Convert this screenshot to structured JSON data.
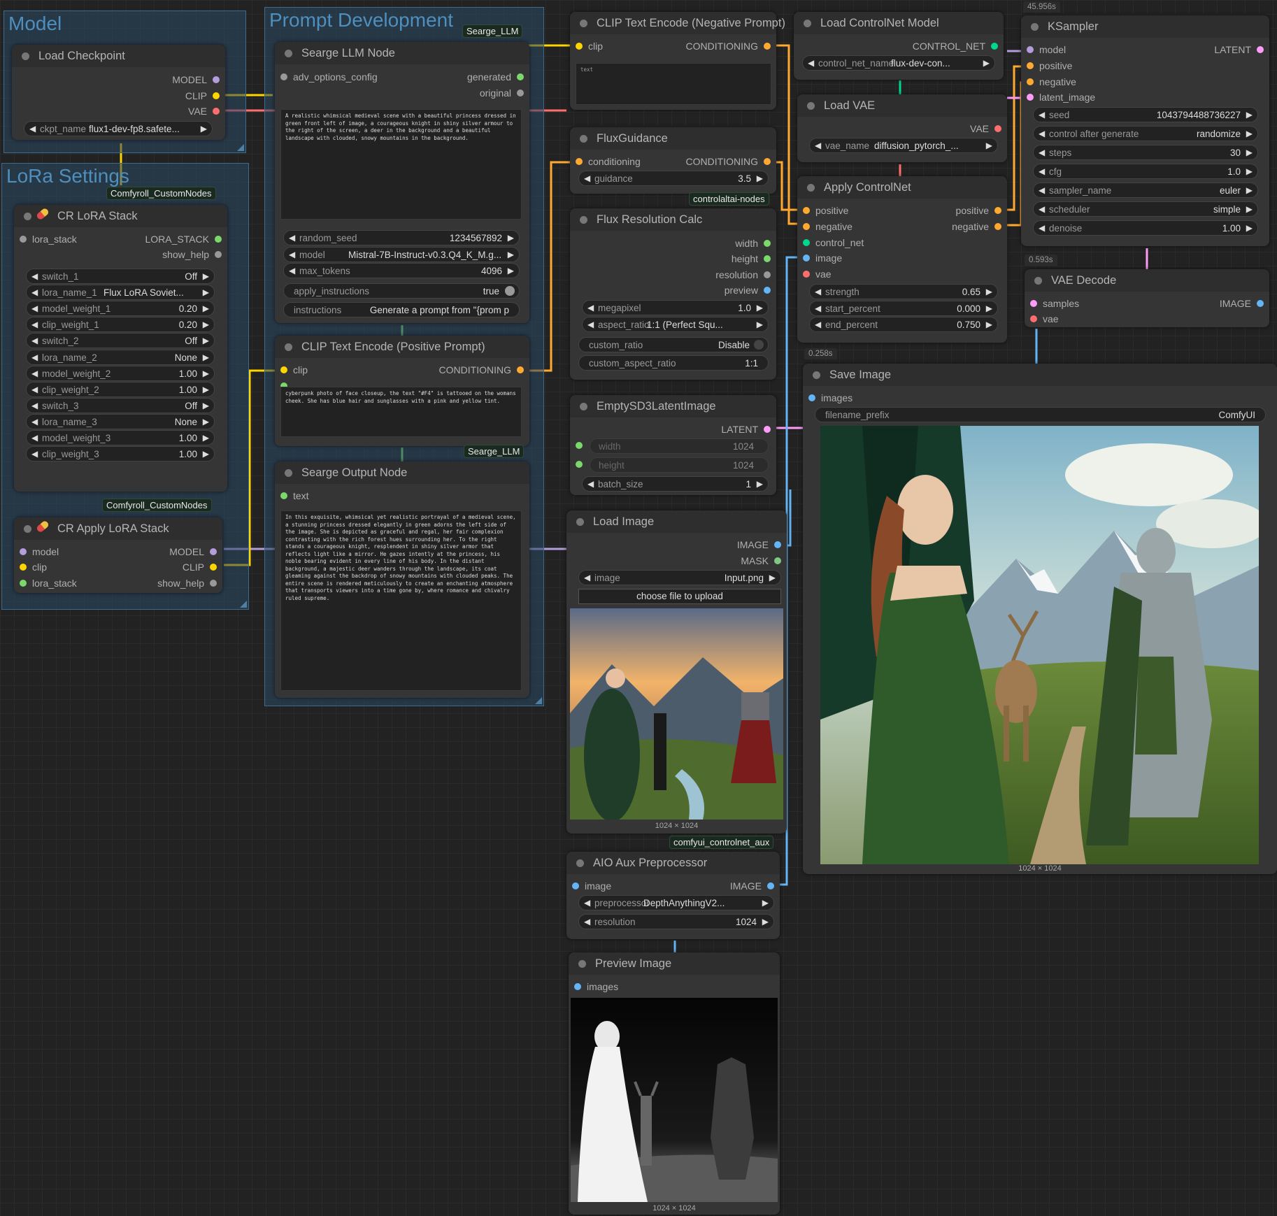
{
  "groups": {
    "model": "Model",
    "lora": "LoRa Settings",
    "prompt": "Prompt Development"
  },
  "badges": {
    "searge1": "Searge_LLM",
    "searge2": "Searge_LLM",
    "comfyroll1": "Comfyroll_CustomNodes",
    "comfyroll2": "Comfyroll_CustomNodes",
    "controlaltai": "controlaltai-nodes",
    "controlnet_aux": "comfyui_controlnet_aux"
  },
  "timings": {
    "ksampler": "45.956s",
    "vae_decode": "0.593s",
    "save_image": "0.258s"
  },
  "colors": {
    "model": "#b39ddb",
    "clip": "#ffd500",
    "vae": "#ff6e6e",
    "conditioning": "#ffa931",
    "latent": "#ff9cf9",
    "image": "#64b5f6",
    "mask": "#81c784",
    "control_net": "#00d78d",
    "generic": "#7bd96b"
  },
  "load_checkpoint": {
    "title": "Load Checkpoint",
    "out_model": "MODEL",
    "out_clip": "CLIP",
    "out_vae": "VAE",
    "w_ckpt_label": "ckpt_name",
    "w_ckpt_value": "flux1-dev-fp8.safete..."
  },
  "lora_stack": {
    "title": "CR LoRA Stack",
    "in_lora_stack": "lora_stack",
    "out_lora_stack": "LORA_STACK",
    "out_show_help": "show_help",
    "widgets": [
      {
        "label": "switch_1",
        "value": "Off"
      },
      {
        "label": "lora_name_1",
        "value": "Flux LoRA Soviet..."
      },
      {
        "label": "model_weight_1",
        "value": "0.20"
      },
      {
        "label": "clip_weight_1",
        "value": "0.20"
      },
      {
        "label": "switch_2",
        "value": "Off"
      },
      {
        "label": "lora_name_2",
        "value": "None"
      },
      {
        "label": "model_weight_2",
        "value": "1.00"
      },
      {
        "label": "clip_weight_2",
        "value": "1.00"
      },
      {
        "label": "switch_3",
        "value": "Off"
      },
      {
        "label": "lora_name_3",
        "value": "None"
      },
      {
        "label": "model_weight_3",
        "value": "1.00"
      },
      {
        "label": "clip_weight_3",
        "value": "1.00"
      }
    ]
  },
  "apply_lora": {
    "title": "CR Apply LoRA Stack",
    "in_model": "model",
    "in_clip": "clip",
    "in_lora_stack": "lora_stack",
    "out_model": "MODEL",
    "out_clip": "CLIP",
    "out_show_help": "show_help"
  },
  "searge_llm": {
    "title": "Searge LLM Node",
    "in_adv": "adv_options_config",
    "out_generated": "generated",
    "out_original": "original",
    "text": "A realistic whimsical medieval scene with a beautiful princess dressed in green front left of image, a courageous knight in shiny silver armour to the right of the screen, a deer in the background and a beautiful landscape with clouded, snowy mountains in the background.",
    "widgets": [
      {
        "label": "random_seed",
        "value": "1234567892"
      },
      {
        "label": "model",
        "value": "Mistral-7B-Instruct-v0.3.Q4_K_M.g..."
      },
      {
        "label": "max_tokens",
        "value": "4096"
      }
    ],
    "apply_label": "apply_instructions",
    "apply_value": "true",
    "instr_label": "instructions",
    "instr_value": "Generate a prompt from \"{prom p"
  },
  "clip_pos": {
    "title": "CLIP Text Encode (Positive Prompt)",
    "in_clip": "clip",
    "out_cond": "CONDITIONING",
    "text": "cyberpunk photo of face closeup, the text \"#F4\" is tattooed on the womans cheek. She has blue hair and sunglasses with a pink and yellow tint."
  },
  "searge_output": {
    "title": "Searge Output Node",
    "in_text": "text",
    "text": "In this exquisite, whimsical yet realistic portrayal of a medieval scene, a stunning princess dressed elegantly in green adorns the left side of the image. She is depicted as graceful and regal, her fair complexion contrasting with the rich forest hues surrounding her. To the right stands a courageous knight, resplendent in shiny silver armor that reflects light like a mirror. He gazes intently at the princess, his noble bearing evident in every line of his body. In the distant background, a majestic deer wanders through the landscape, its coat gleaming against the backdrop of snowy mountains with clouded peaks. The entire scene is rendered meticulously to create an enchanting atmosphere that transports viewers into a time gone by, where romance and chivalry ruled supreme."
  },
  "clip_neg": {
    "title": "CLIP Text Encode (Negative Prompt)",
    "in_clip": "clip",
    "out_cond": "CONDITIONING",
    "text": "text"
  },
  "flux_guidance": {
    "title": "FluxGuidance",
    "in_cond": "conditioning",
    "out_cond": "CONDITIONING",
    "w_label": "guidance",
    "w_value": "3.5"
  },
  "flux_res": {
    "title": "Flux Resolution Calc",
    "out_width": "width",
    "out_height": "height",
    "out_resolution": "resolution",
    "out_preview": "preview",
    "widgets": [
      {
        "label": "megapixel",
        "value": "1.0"
      },
      {
        "label": "aspect_ratio",
        "value": "1:1 (Perfect Squ..."
      }
    ],
    "custom_ratio_label": "custom_ratio",
    "custom_ratio_value": "Disable",
    "custom_aspect_label": "custom_aspect_ratio",
    "custom_aspect_value": "1:1"
  },
  "empty_latent": {
    "title": "EmptySD3LatentImage",
    "out_latent": "LATENT",
    "w_width_label": "width",
    "w_width_value": "1024",
    "w_height_label": "height",
    "w_height_value": "1024",
    "w_batch_label": "batch_size",
    "w_batch_value": "1"
  },
  "load_image": {
    "title": "Load Image",
    "out_image": "IMAGE",
    "out_mask": "MASK",
    "w_label": "image",
    "w_value": "Input.png",
    "upload": "choose file to upload",
    "caption": "1024 × 1024"
  },
  "aio": {
    "title": "AIO Aux Preprocessor",
    "in_image": "image",
    "out_image": "IMAGE",
    "w1_label": "preprocessor",
    "w1_value": "DepthAnythingV2...",
    "w2_label": "resolution",
    "w2_value": "1024"
  },
  "preview": {
    "title": "Preview Image",
    "in_images": "images",
    "caption": "1024 × 1024"
  },
  "load_controlnet": {
    "title": "Load ControlNet Model",
    "out_cn": "CONTROL_NET",
    "w_label": "control_net_name",
    "w_value": "flux-dev-con..."
  },
  "load_vae": {
    "title": "Load VAE",
    "out_vae": "VAE",
    "w_label": "vae_name",
    "w_value": "diffusion_pytorch_..."
  },
  "apply_cn": {
    "title": "Apply ControlNet",
    "in_pos": "positive",
    "in_neg": "negative",
    "in_cn": "control_net",
    "in_image": "image",
    "in_vae": "vae",
    "out_pos": "positive",
    "out_neg": "negative",
    "widgets": [
      {
        "label": "strength",
        "value": "0.65"
      },
      {
        "label": "start_percent",
        "value": "0.000"
      },
      {
        "label": "end_percent",
        "value": "0.750"
      }
    ]
  },
  "ksampler": {
    "title": "KSampler",
    "in_model": "model",
    "in_pos": "positive",
    "in_neg": "negative",
    "in_latent": "latent_image",
    "out_latent": "LATENT",
    "widgets": [
      {
        "label": "seed",
        "value": "1043794488736227"
      },
      {
        "label": "control after generate",
        "value": "randomize"
      },
      {
        "label": "steps",
        "value": "30"
      },
      {
        "label": "cfg",
        "value": "1.0"
      },
      {
        "label": "sampler_name",
        "value": "euler"
      },
      {
        "label": "scheduler",
        "value": "simple"
      },
      {
        "label": "denoise",
        "value": "1.00"
      }
    ]
  },
  "vae_decode": {
    "title": "VAE Decode",
    "in_samples": "samples",
    "in_vae": "vae",
    "out_image": "IMAGE"
  },
  "save_image": {
    "title": "Save Image",
    "in_images": "images",
    "w_label": "filename_prefix",
    "w_value": "ComfyUI",
    "caption": "1024 × 1024"
  }
}
